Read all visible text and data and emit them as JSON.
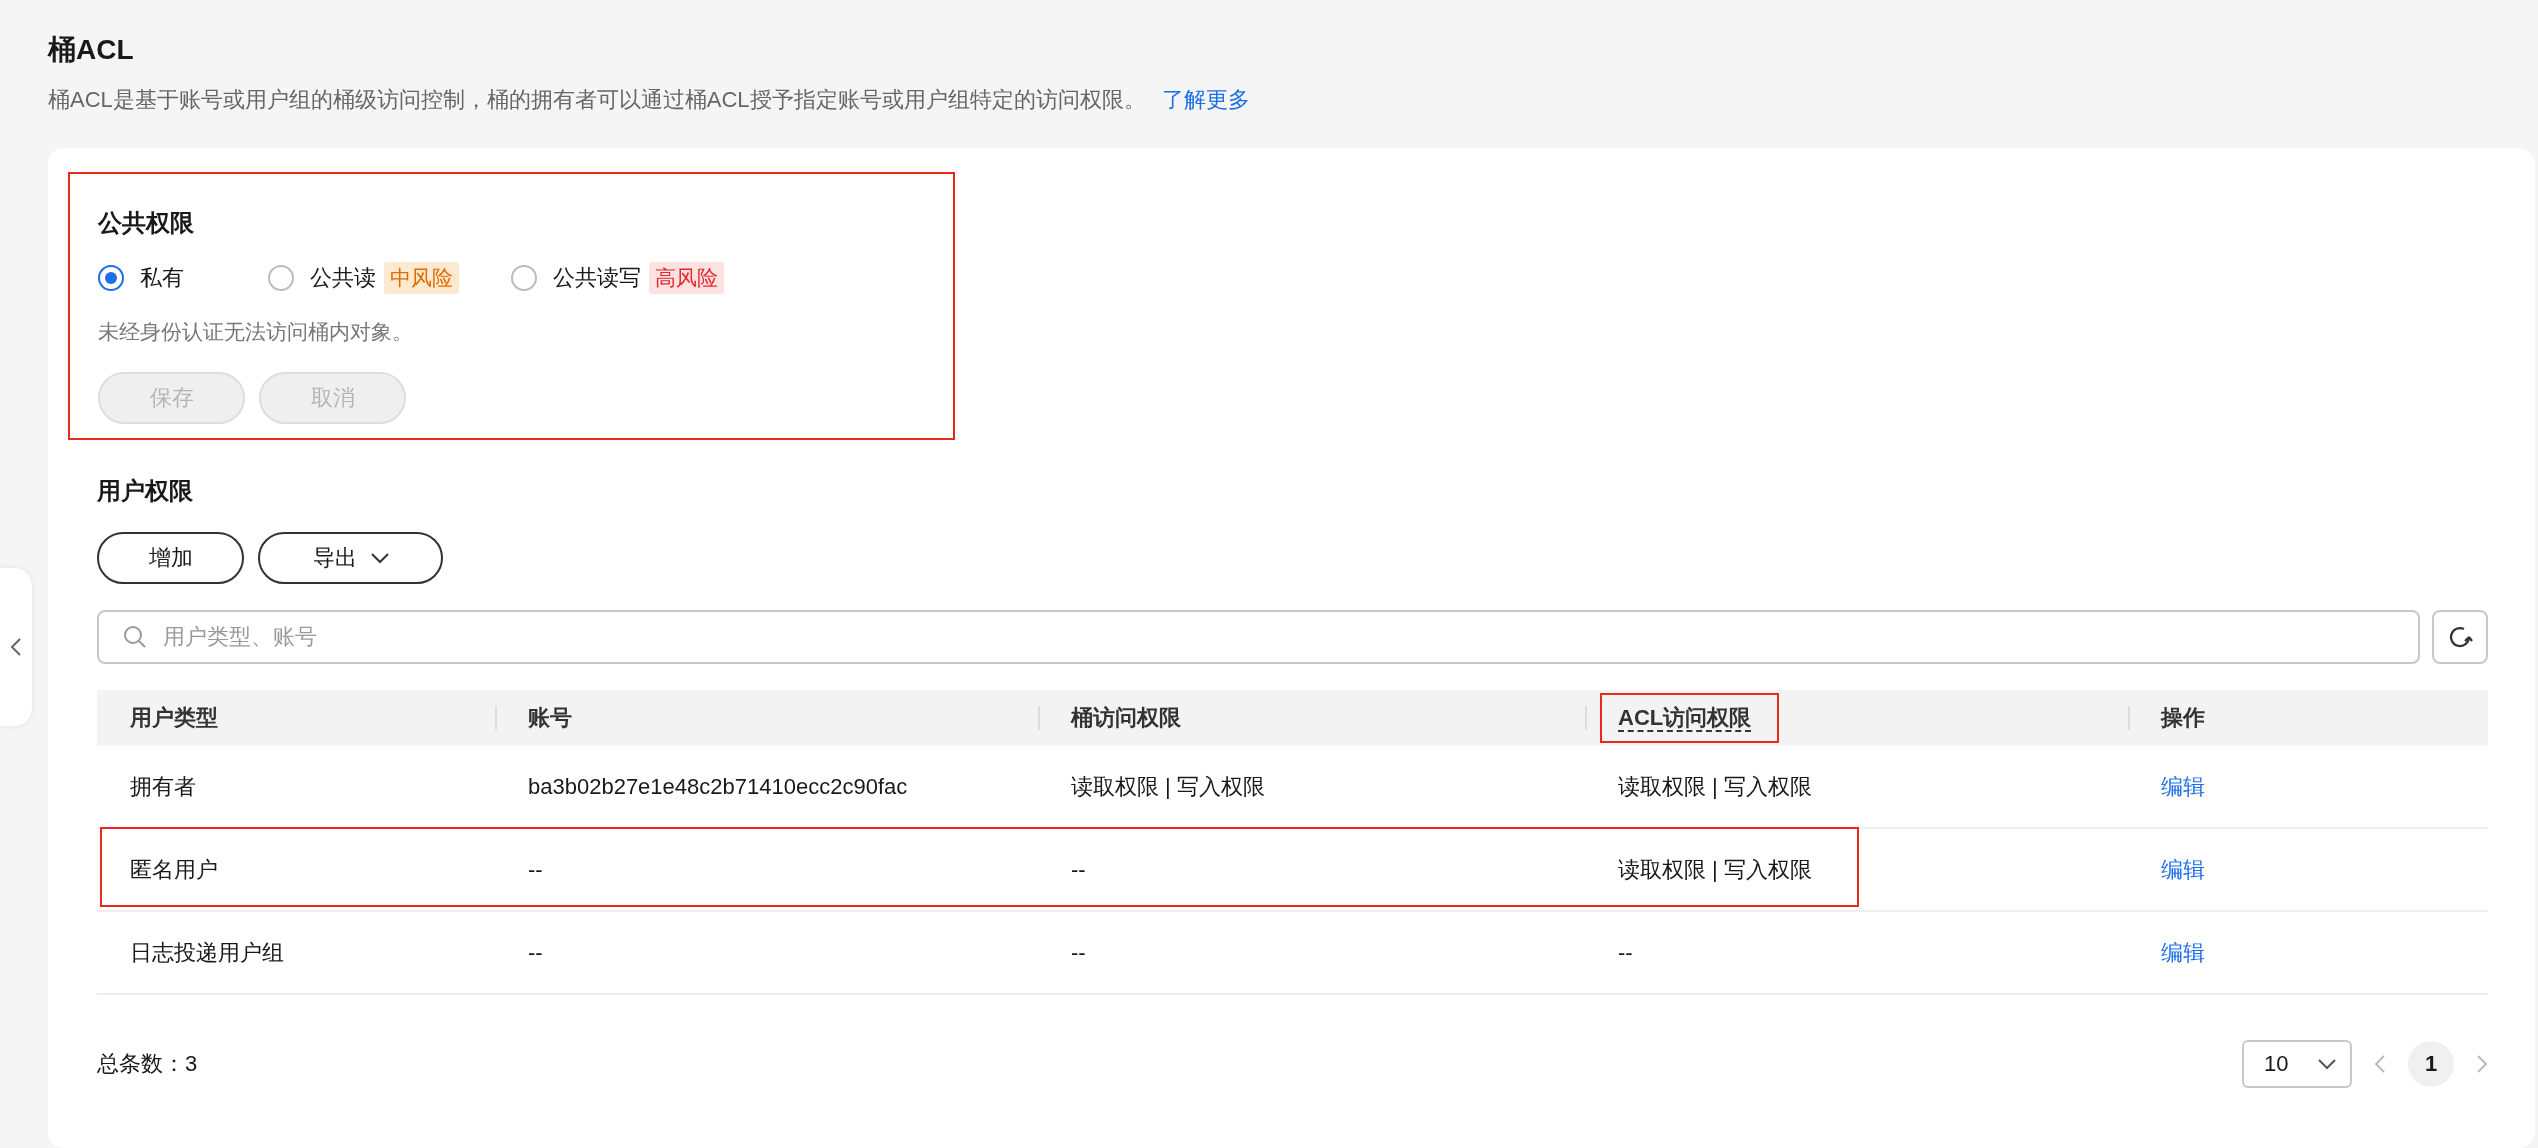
{
  "page": {
    "title": "桶ACL",
    "description": "桶ACL是基于账号或用户组的桶级访问控制，桶的拥有者可以通过桶ACL授予指定账号或用户组特定的访问权限。",
    "learn_more_link": "了解更多"
  },
  "public_permissions": {
    "title": "公共权限",
    "highlighted": true,
    "options": [
      {
        "label": "私有",
        "selected": true
      },
      {
        "label": "公共读",
        "selected": false,
        "risk_tag": "中风险",
        "kind": "medium"
      },
      {
        "label": "公共读写",
        "selected": false,
        "risk_tag": "高风险",
        "kind": "high"
      }
    ],
    "hint": "未经身份认证无法访问桶内对象。",
    "buttons": [
      {
        "label": "保存",
        "disabled": true
      },
      {
        "label": "取消",
        "disabled": true
      }
    ]
  },
  "user_permissions": {
    "title": "用户权限",
    "toolbar": {
      "add_button": "增加",
      "export_button": "导出"
    },
    "search": {
      "placeholder": "用户类型、账号"
    },
    "table": {
      "columns": [
        {
          "label": "用户类型",
          "highlighted": false,
          "has_tooltip": false
        },
        {
          "label": "账号",
          "highlighted": false,
          "has_tooltip": false
        },
        {
          "label": "桶访问权限",
          "highlighted": false,
          "has_tooltip": false
        },
        {
          "label": "ACL访问权限",
          "highlighted": true,
          "has_tooltip": true
        },
        {
          "label": "操作",
          "highlighted": false,
          "has_tooltip": false
        }
      ],
      "rows": [
        {
          "cells": [
            "拥有者",
            "ba3b02b27e1e48c2b71410ecc2c90fac",
            "读取权限 | 写入权限",
            "读取权限 | 写入权限"
          ],
          "action": "编辑",
          "highlighted": false
        },
        {
          "cells": [
            "匿名用户",
            "--",
            "--",
            "读取权限 | 写入权限"
          ],
          "action": "编辑",
          "highlighted": true
        },
        {
          "cells": [
            "日志投递用户组",
            "--",
            "--",
            "--"
          ],
          "action": "编辑",
          "highlighted": false
        }
      ]
    },
    "footer": {
      "total": "总条数：3",
      "page_size": "10",
      "pages": [
        {
          "label": "1",
          "selected": true
        }
      ]
    }
  }
}
